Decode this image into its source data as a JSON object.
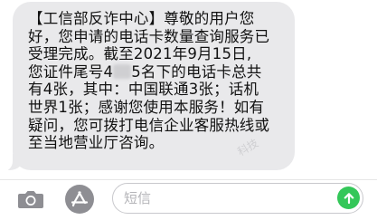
{
  "message": {
    "lines": [
      "【工信部反诈中心】尊敬的用户您",
      "好，您申请的电话卡数量查询服务已",
      "受理完成。截至2021年9月15日,",
      "名下的电话卡总共",
      "有4张，其中：中国联通3张；话机",
      "世界1张；感谢您使用本服务！如有",
      "疑问，您可拨打电信企业客服热线或",
      "至当地营业厅咨询。"
    ],
    "line4_prefix": "您证件尾号4",
    "line4_mid": "5"
  },
  "watermark": "科技",
  "composer": {
    "placeholder": "短信"
  },
  "icons": {
    "camera": "camera-icon",
    "apps": "app-store-icon",
    "send": "send-arrow-icon"
  },
  "colors": {
    "bubble": "#e9e9eb",
    "send": "#34c759",
    "icon_gray": "#8e8e93"
  }
}
